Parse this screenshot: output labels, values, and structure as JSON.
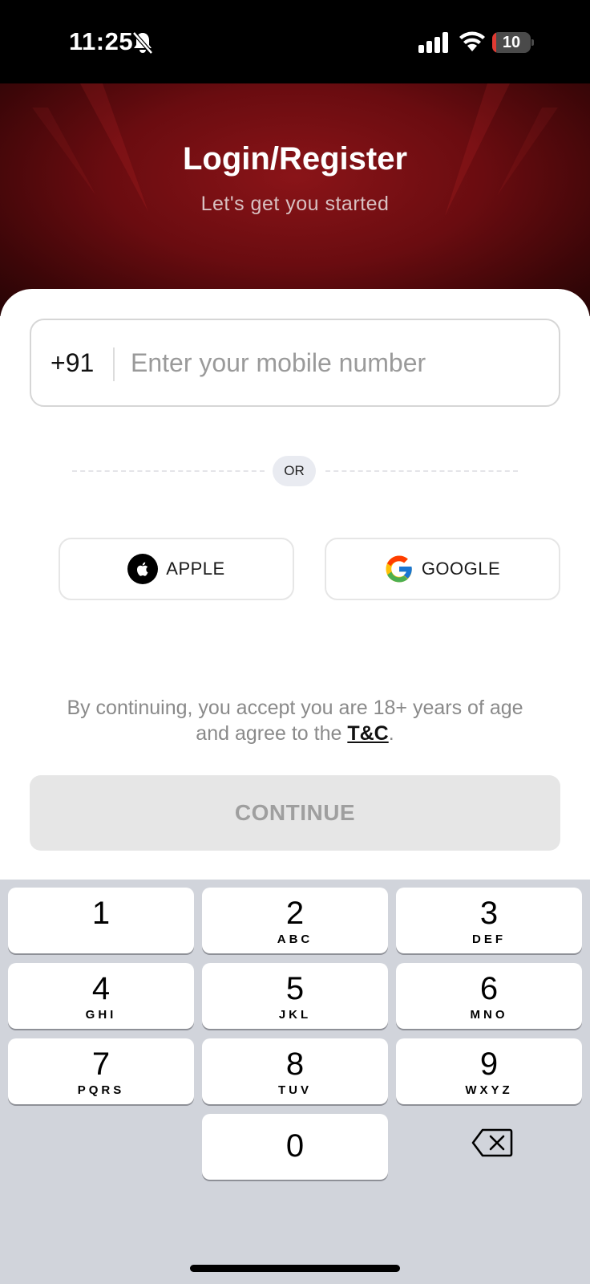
{
  "status_bar": {
    "time": "11:25",
    "battery_level": "10",
    "battery_fraction": 0.1,
    "battery_color": "#e03a32",
    "icons": [
      "bell-off-icon",
      "signal-icon",
      "wifi-icon"
    ]
  },
  "header": {
    "title": "Login/Register",
    "subtitle": "Let's get you started",
    "background_color": "#6a0c10"
  },
  "phone_field": {
    "country_code": "+91",
    "placeholder": "Enter your mobile number",
    "value": ""
  },
  "divider": {
    "label": "OR"
  },
  "social": {
    "apple_label": "APPLE",
    "google_label": "GOOGLE",
    "apple_icon": "apple-icon",
    "google_icon": "google-icon"
  },
  "terms": {
    "text_before": "By continuing, you accept you are 18+ years of age and agree to the ",
    "link": "T&C",
    "text_after": "."
  },
  "continue_button": {
    "label": "CONTINUE",
    "enabled": false
  },
  "keypad": {
    "keys": [
      {
        "num": "1",
        "letters": ""
      },
      {
        "num": "2",
        "letters": "ABC"
      },
      {
        "num": "3",
        "letters": "DEF"
      },
      {
        "num": "4",
        "letters": "GHI"
      },
      {
        "num": "5",
        "letters": "JKL"
      },
      {
        "num": "6",
        "letters": "MNO"
      },
      {
        "num": "7",
        "letters": "PQRS"
      },
      {
        "num": "8",
        "letters": "TUV"
      },
      {
        "num": "9",
        "letters": "WXYZ"
      },
      {
        "num": "0",
        "letters": ""
      }
    ],
    "delete_icon": "backspace-icon"
  }
}
